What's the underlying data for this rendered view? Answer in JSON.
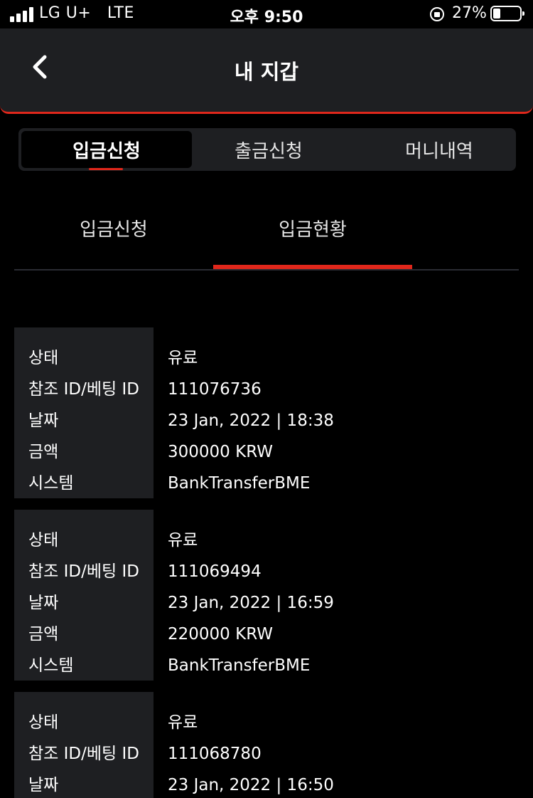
{
  "status_bar": {
    "carrier": "LG U+   LTE",
    "time": "오후 9:50",
    "battery": "27%"
  },
  "header": {
    "title": "내 지갑"
  },
  "segment_tabs": [
    {
      "label": "입금신청",
      "active": true
    },
    {
      "label": "출금신청",
      "active": false
    },
    {
      "label": "머니내역",
      "active": false
    }
  ],
  "sub_tabs": [
    {
      "label": "입금신청",
      "active": false
    },
    {
      "label": "입금현황",
      "active": true
    }
  ],
  "field_labels": {
    "status": "상태",
    "ref": "참조 ID/베팅 ID",
    "date": "날짜",
    "amount": "금액",
    "system": "시스템"
  },
  "records": [
    {
      "status": "유료",
      "ref": "111076736",
      "date": "23 Jan, 2022 | 18:38",
      "amount": "300000 KRW",
      "system": "BankTransferBME"
    },
    {
      "status": "유료",
      "ref": "111069494",
      "date": "23 Jan, 2022 | 16:59",
      "amount": "220000 KRW",
      "system": "BankTransferBME"
    },
    {
      "status": "유료",
      "ref": "111068780",
      "date": "23 Jan, 2022 | 16:50",
      "amount": "",
      "system": ""
    }
  ],
  "colors": {
    "accent": "#e0271b",
    "panel": "#1e1f22",
    "background": "#000000"
  },
  "icons": [
    "signal-icon",
    "back-arrow-icon",
    "rotation-lock-icon",
    "battery-icon"
  ]
}
